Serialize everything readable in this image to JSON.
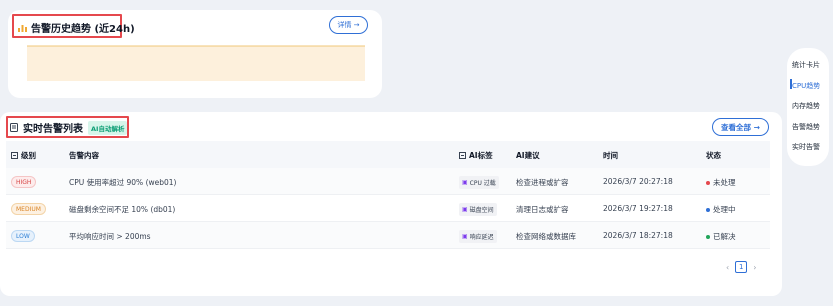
{
  "trend": {
    "title": "告警历史趋势 (近24h)",
    "detail_label": "详情 →",
    "colors": {
      "area_fill": "#fdf0dc",
      "line": "#f0c77a"
    }
  },
  "side_nav": {
    "items": [
      {
        "label": "统计卡片",
        "active": false
      },
      {
        "label": "CPU趋势",
        "active": true
      },
      {
        "label": "内存趋势",
        "active": false
      },
      {
        "label": "告警趋势",
        "active": false
      },
      {
        "label": "实时告警",
        "active": false
      }
    ]
  },
  "alerts": {
    "title": "实时告警列表",
    "ai_badge": "AI自动解析",
    "view_all_label": "查看全部 →",
    "columns": {
      "level": "级别",
      "content": "告警内容",
      "ai_tag": "AI标签",
      "ai_advice": "AI建议",
      "time": "时间",
      "status": "状态"
    },
    "rows": [
      {
        "level": "HIGH",
        "level_class": "lv-high",
        "content": "CPU 使用率超过 90% (web01)",
        "ai_tag": "CPU 过载",
        "ai_advice": "检查进程或扩容",
        "time": "2026/3/7 20:27:18",
        "status": "未处理",
        "status_color": "#e5484d"
      },
      {
        "level": "MEDIUM",
        "level_class": "lv-medium",
        "content": "磁盘剩余空间不足 10% (db01)",
        "ai_tag": "磁盘空间",
        "ai_advice": "清理日志或扩容",
        "time": "2026/3/7 19:27:18",
        "status": "处理中",
        "status_color": "#2f6fd6"
      },
      {
        "level": "LOW",
        "level_class": "lv-low",
        "content": "平均响应时间 > 200ms",
        "ai_tag": "响应延迟",
        "ai_advice": "检查网络或数据库",
        "time": "2026/3/7 18:27:18",
        "status": "已解决",
        "status_color": "#22a55a"
      }
    ],
    "pagination": {
      "prev": "‹",
      "current": "1",
      "next": "›"
    }
  }
}
